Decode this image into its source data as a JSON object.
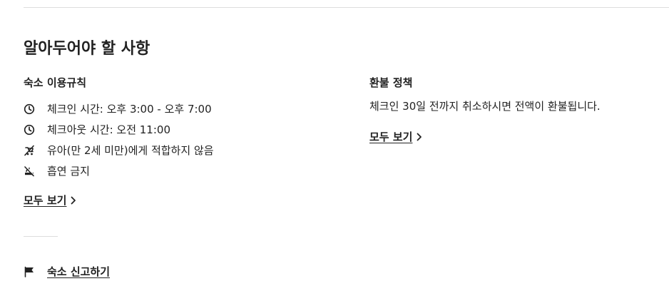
{
  "section_title": "알아두어야 할 사항",
  "house_rules": {
    "heading": "숙소 이용규칙",
    "items": [
      {
        "icon": "clock-icon",
        "text": "체크인 시간: 오후 3:00 - 오후 7:00"
      },
      {
        "icon": "clock-icon",
        "text": "체크아웃 시간: 오전 11:00"
      },
      {
        "icon": "no-stroller-icon",
        "text": "유아(만 2세 미만)에게 적합하지 않음"
      },
      {
        "icon": "no-smoking-icon",
        "text": "흡연 금지"
      }
    ],
    "show_all_label": "모두 보기"
  },
  "refund_policy": {
    "heading": "환불 정책",
    "text": "체크인 30일 전까지 취소하시면 전액이 환불됩니다.",
    "show_all_label": "모두 보기"
  },
  "report": {
    "icon": "flag-icon",
    "label": "숙소 신고하기"
  },
  "colors": {
    "text": "#222222",
    "divider": "#dddddd",
    "background": "#ffffff"
  }
}
